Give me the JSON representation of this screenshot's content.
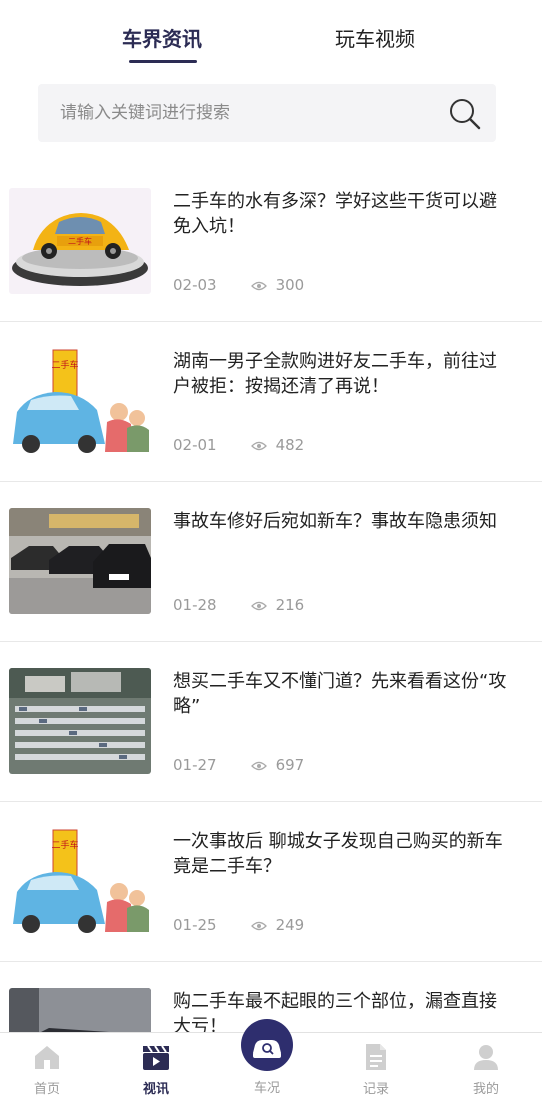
{
  "tabs": {
    "active": "车界资讯",
    "inactive": "玩车视频"
  },
  "search": {
    "placeholder": "请输入关键词进行搜索"
  },
  "articles": [
    {
      "title": "二手车的水有多深？学好这些干货可以避免入坑！",
      "date": "02-03",
      "views": "300"
    },
    {
      "title": "湖南一男子全款购进好友二手车，前往过户被拒：按揭还清了再说！",
      "date": "02-01",
      "views": "482"
    },
    {
      "title": "事故车修好后宛如新车？事故车隐患须知",
      "date": "01-28",
      "views": "216"
    },
    {
      "title": "想买二手车又不懂门道？先来看看这份“攻略”",
      "date": "01-27",
      "views": "697"
    },
    {
      "title": "一次事故后 聊城女子发现自己购买的新车竟是二手车？",
      "date": "01-25",
      "views": "249"
    },
    {
      "title": "购二手车最不起眼的三个部位，漏查直接大亏！",
      "date": "",
      "views": ""
    }
  ],
  "thumb_signs": {
    "used_car": "二手车"
  },
  "bottom_nav": {
    "home": "首页",
    "video": "视讯",
    "car_status": "车况",
    "records": "记录",
    "mine": "我的"
  },
  "colors": {
    "accent": "#2c2c54",
    "center_button": "#2e2e6e",
    "muted": "#9b9b9b"
  }
}
